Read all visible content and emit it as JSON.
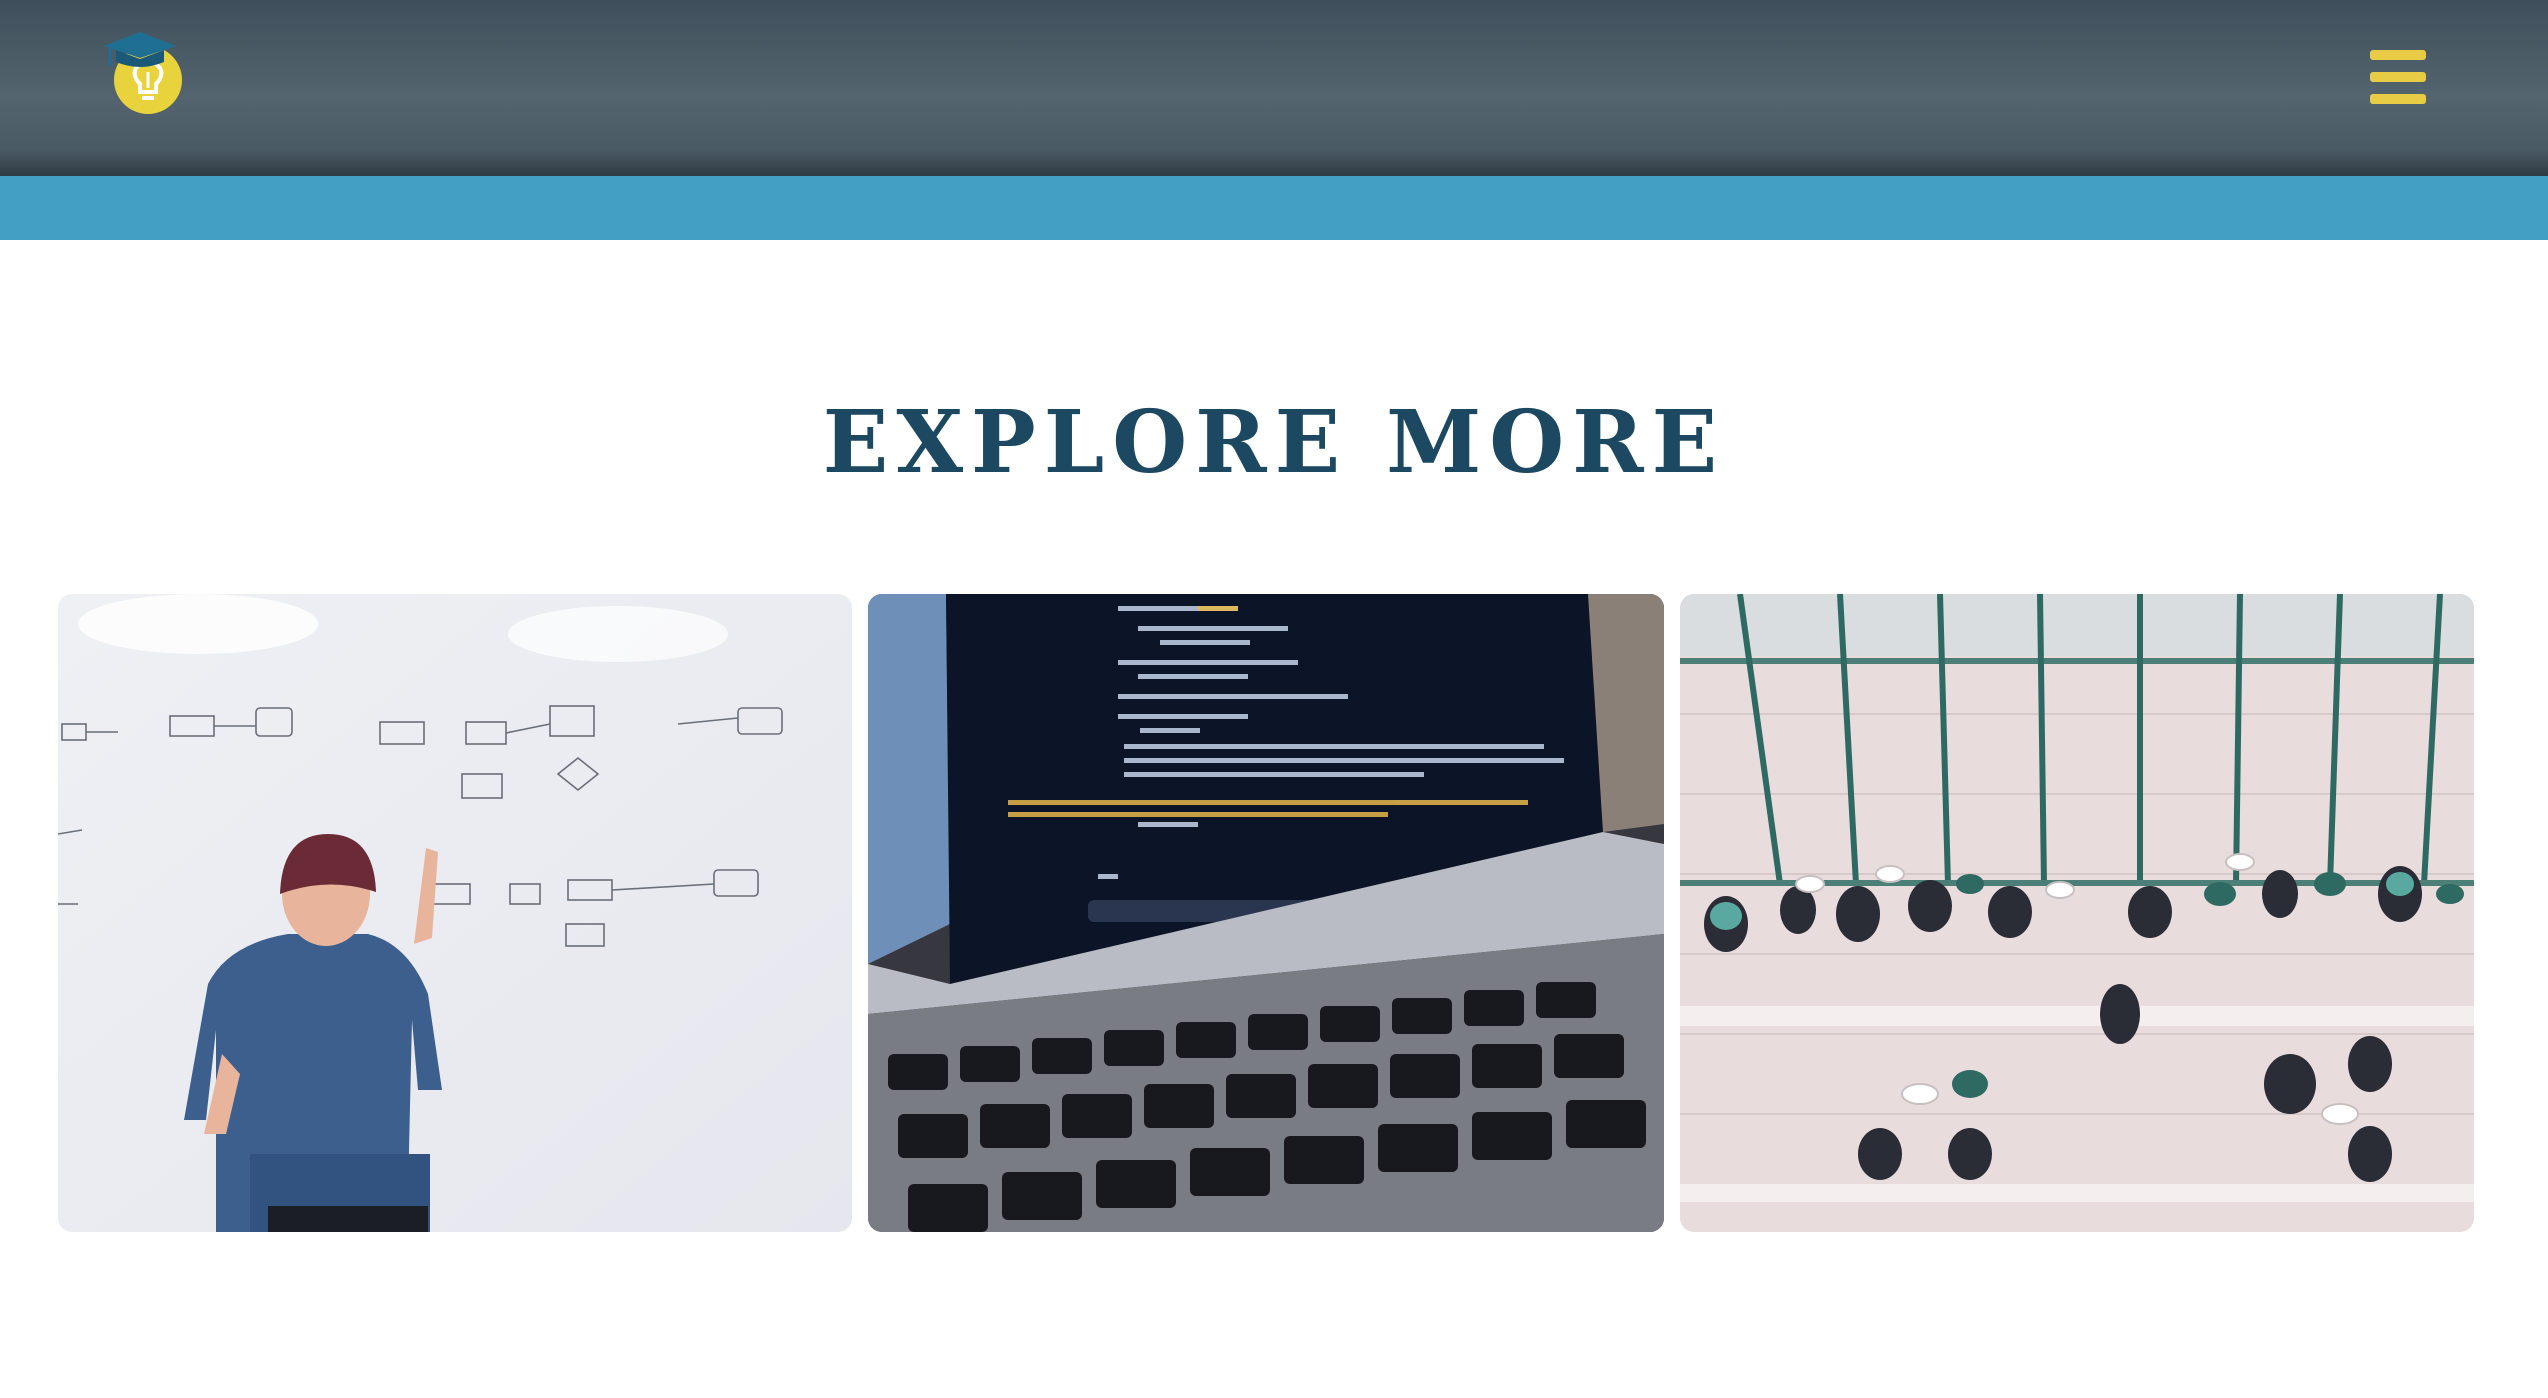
{
  "header": {
    "logo_icon": "graduation-cap-lightbulb-icon",
    "menu_icon": "hamburger-menu-icon",
    "background_color": "#4f5f6a",
    "accent_color": "#e9cc45"
  },
  "accent_strip": {
    "color": "#41a0c4"
  },
  "explore": {
    "title": "EXPLORE MORE",
    "title_color": "#1d4862",
    "cards": [
      {
        "image": "person-at-whiteboard-photo"
      },
      {
        "image": "laptop-code-screen-photo"
      },
      {
        "image": "people-in-atrium-photo"
      }
    ]
  }
}
